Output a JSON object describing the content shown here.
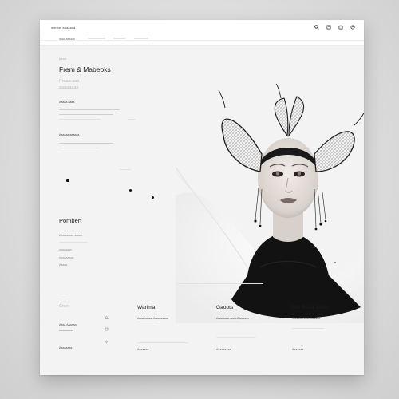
{
  "header": {
    "brand": "mmmm aaaaaaa",
    "subtab": "aaaa aaaaaa"
  },
  "toolbar_icons": [
    "search-icon",
    "bag-icon",
    "cart-icon",
    "user-icon"
  ],
  "hero": {
    "eyebrow": "aaaa",
    "title": "Frem & Mabeoks",
    "tagline_1": "Praaa  aaa",
    "tagline_2": "aaaaaaaa",
    "meta_1": "Aaaaa  aaaa",
    "meta_2": "Aaaaaa  aaaaaa"
  },
  "promo": {
    "title": "Pombert",
    "link_1": "Aaaaaaaaa aaaaa",
    "link_2": "aaaaaaaa",
    "link_3": "Aaaaaaaaa",
    "link_4": "Aaaaa"
  },
  "footer": {
    "left_title": "Cnen",
    "left_item_1": "Aaaa  Aaaaaa",
    "left_item_2": "aaaaaaaaa",
    "left_item_3": "Aaaaaaaa",
    "columns": [
      {
        "title": "Warima",
        "line_1": "Aaaa  aaaaa  Aaaaaaaaa",
        "line_2": "Aaaaaaa"
      },
      {
        "title": "Gaoots",
        "line_1": "Aaaaaaaa  aaaa  Aaaaaaa",
        "line_2": "Aaaaaaaaa"
      },
      {
        "title": "Not Foua Jeoks",
        "line_1": "Aaaaaa  Aaaa  aaaaaa",
        "line_2": "Aaaaaaa"
      }
    ]
  },
  "colors": {
    "background": "#d7d7d7",
    "sheet": "#f3f3f3",
    "ink": "#1e1e1e",
    "accent": "#111111"
  }
}
